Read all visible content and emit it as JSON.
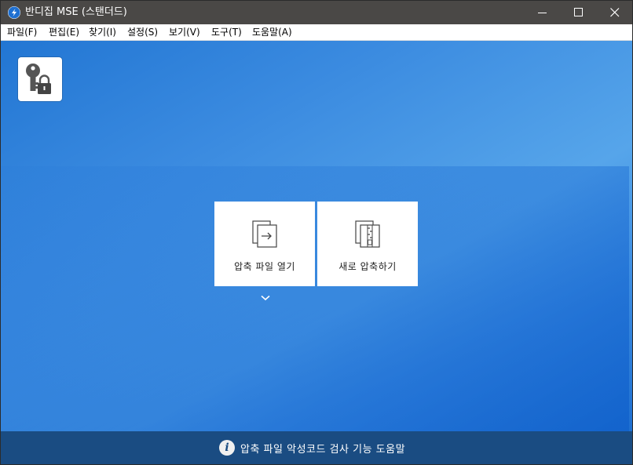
{
  "window": {
    "title": "반디집 MSE (스탠더드)"
  },
  "menubar": {
    "items": [
      {
        "label": "파일(F)"
      },
      {
        "label": "편집(E)"
      },
      {
        "label": "찾기(I)"
      },
      {
        "label": "설정(S)"
      },
      {
        "label": "보기(V)"
      },
      {
        "label": "도구(T)"
      },
      {
        "label": "도움말(A)"
      }
    ]
  },
  "main": {
    "tools_icon": "key-lock-icon",
    "tiles": [
      {
        "label": "압축 파일 열기",
        "icon": "open-archive-icon"
      },
      {
        "label": "새로 압축하기",
        "icon": "new-archive-icon"
      }
    ],
    "dropdown_icon": "chevron-down-icon"
  },
  "footer": {
    "info_glyph": "i",
    "text": "압축 파일 악성코드 검사 기능 도움말"
  },
  "colors": {
    "titlebar": "#4a4846",
    "accent_blue": "#2276d3",
    "footer": "#1a4c82"
  }
}
